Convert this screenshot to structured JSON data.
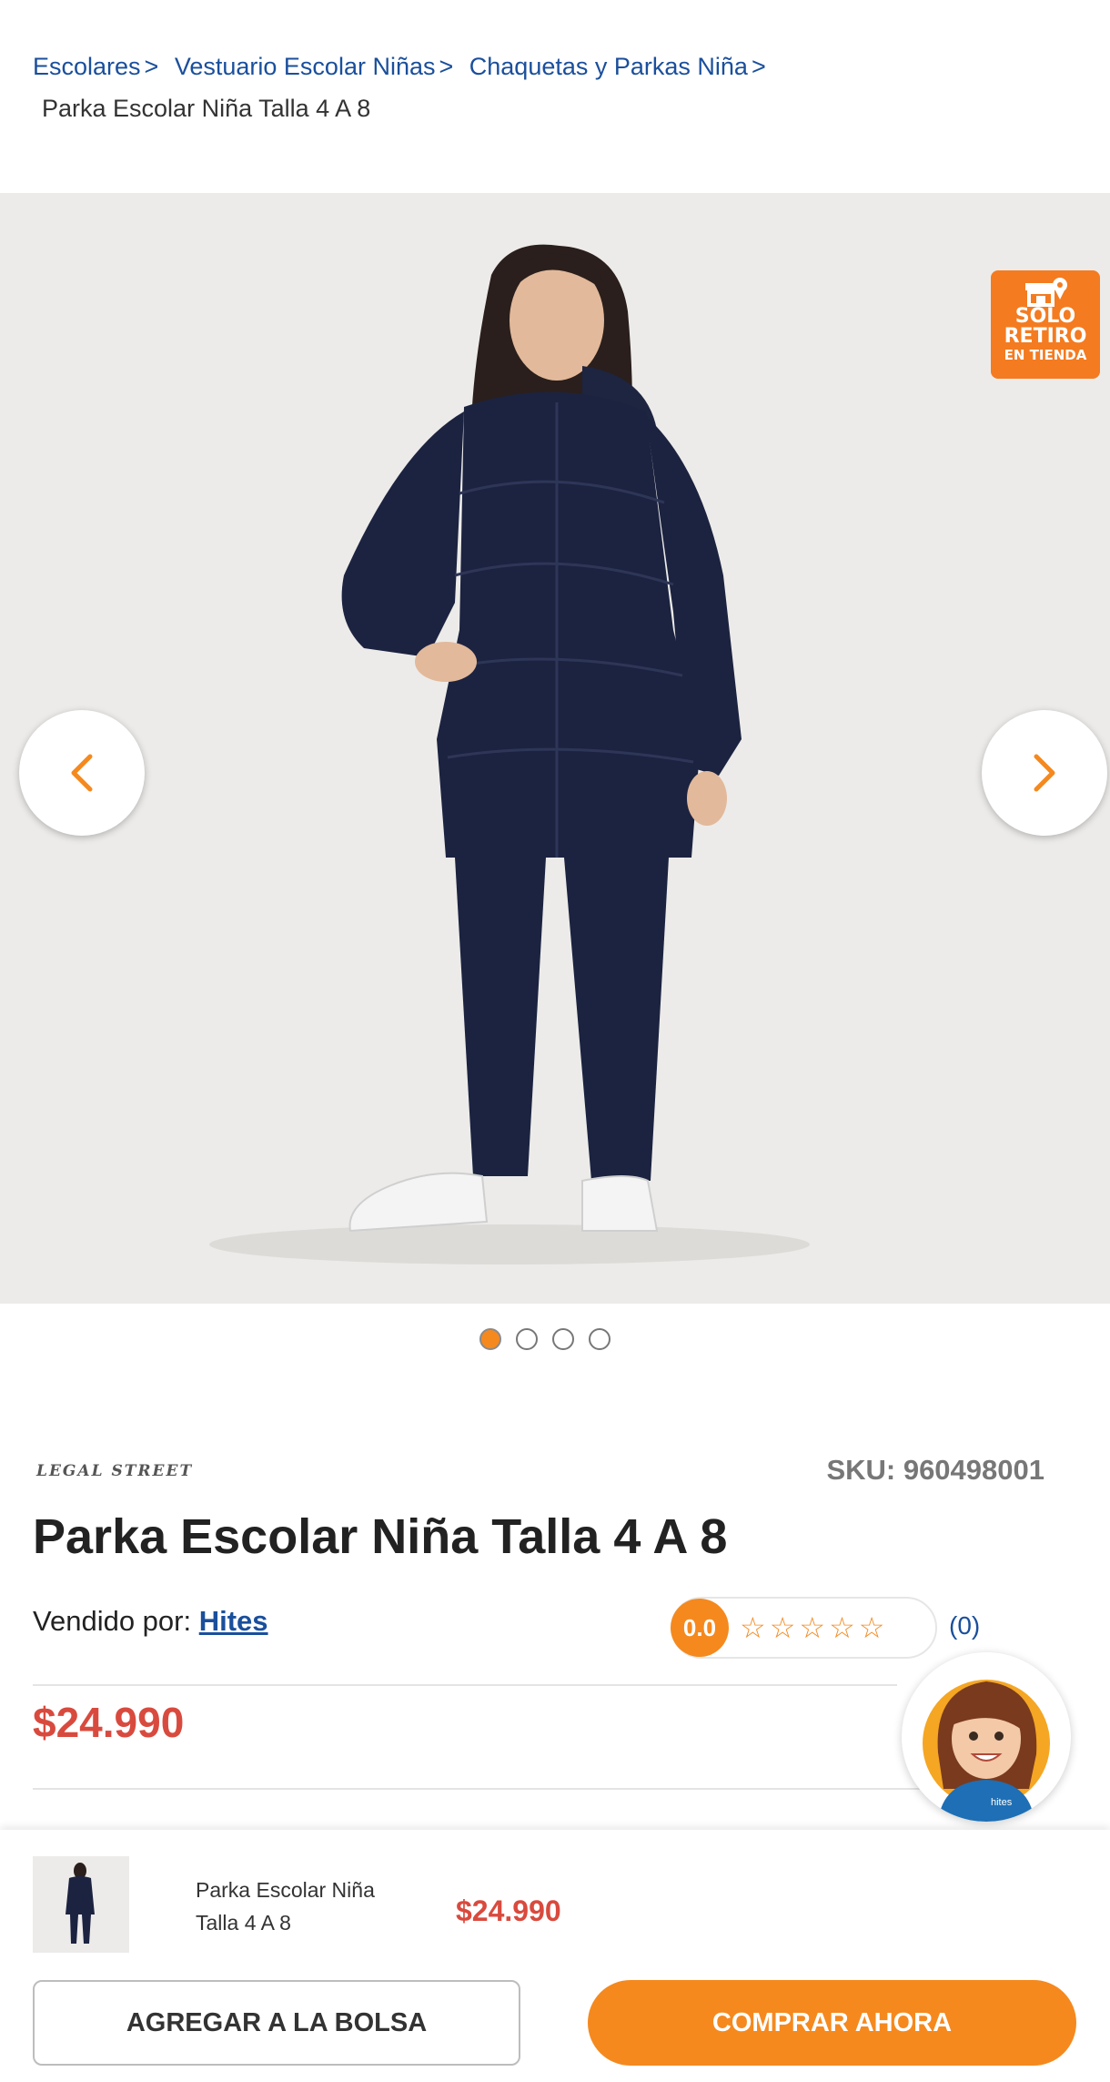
{
  "breadcrumb": {
    "items": [
      {
        "label": "Escolares",
        "sep": ">"
      },
      {
        "label": "Vestuario Escolar Niñas",
        "sep": ">"
      },
      {
        "label": "Chaquetas y Parkas Niña",
        "sep": ">"
      }
    ],
    "current": "Parka Escolar Niña Talla 4 A 8"
  },
  "gallery": {
    "badge": {
      "line1": "SOLO",
      "line2": "RETIRO",
      "line3": "EN TIENDA"
    },
    "prev_icon": "chevron-left-icon",
    "next_icon": "chevron-right-icon",
    "active_index": 0,
    "total": 4
  },
  "product": {
    "brand": "LEGAL STREET",
    "sku": "SKU: 960498001",
    "title": "Parka Escolar Niña Talla 4 A 8",
    "seller_label": "Vendido por:",
    "seller_name": "Hites",
    "rating_score": "0.0",
    "rating_stars": "☆☆☆☆☆",
    "rating_count": "(0)",
    "price": "$24.990"
  },
  "assistant": {
    "label": "hites"
  },
  "sticky_bar": {
    "name": "Parka Escolar Niña Talla 4 A 8",
    "price": "$24.990",
    "add_label": "AGREGAR A LA BOLSA",
    "buy_label": "COMPRAR AHORA"
  },
  "colors": {
    "accent": "#f5891e",
    "link": "#1a4f9c",
    "price": "#d94a3e",
    "badge": "#f47b20"
  }
}
